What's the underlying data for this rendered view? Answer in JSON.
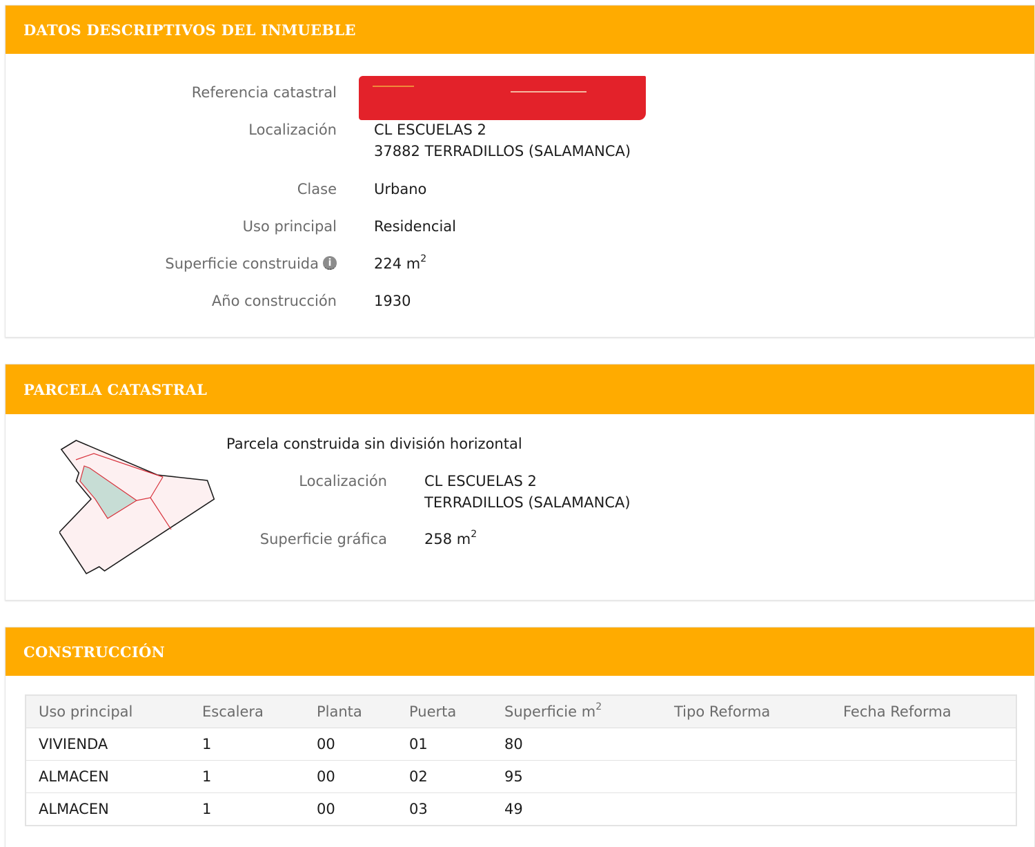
{
  "datos": {
    "title": "DATOS DESCRIPTIVOS DEL INMUEBLE",
    "referencia_label": "Referencia catastral",
    "localizacion_label": "Localización",
    "localizacion_line1": "CL ESCUELAS 2",
    "localizacion_line2": "37882 TERRADILLOS (SALAMANCA)",
    "clase_label": "Clase",
    "clase_value": "Urbano",
    "uso_label": "Uso principal",
    "uso_value": "Residencial",
    "superficie_label": "Superficie construida",
    "superficie_value": "224 m",
    "superficie_exp": "2",
    "anio_label": "Año construcción",
    "anio_value": "1930",
    "info_icon_glyph": "i"
  },
  "parcela": {
    "title": "PARCELA CATASTRAL",
    "subtitle": "Parcela construida sin división horizontal",
    "localizacion_label": "Localización",
    "localizacion_line1": "CL ESCUELAS 2",
    "localizacion_line2": "TERRADILLOS (SALAMANCA)",
    "superficie_label": "Superficie gráfica",
    "superficie_value": "258 m",
    "superficie_exp": "2"
  },
  "construccion": {
    "title": "CONSTRUCCIÓN",
    "columns": [
      "Uso principal",
      "Escalera",
      "Planta",
      "Puerta",
      "Superficie m",
      "Tipo Reforma",
      "Fecha Reforma"
    ],
    "superficie_exp": "2",
    "rows": [
      [
        "VIVIENDA",
        "1",
        "00",
        "01",
        "80",
        "",
        ""
      ],
      [
        "ALMACEN",
        "1",
        "00",
        "02",
        "95",
        "",
        ""
      ],
      [
        "ALMACEN",
        "1",
        "00",
        "03",
        "49",
        "",
        ""
      ]
    ]
  },
  "colors": {
    "header_bg": "#ffab00",
    "redaction": "#e3222a",
    "parcel_fill": "#fdf0f1",
    "parcel_highlight": "#c7ddd5",
    "parcel_inner_line": "#d8323c"
  }
}
